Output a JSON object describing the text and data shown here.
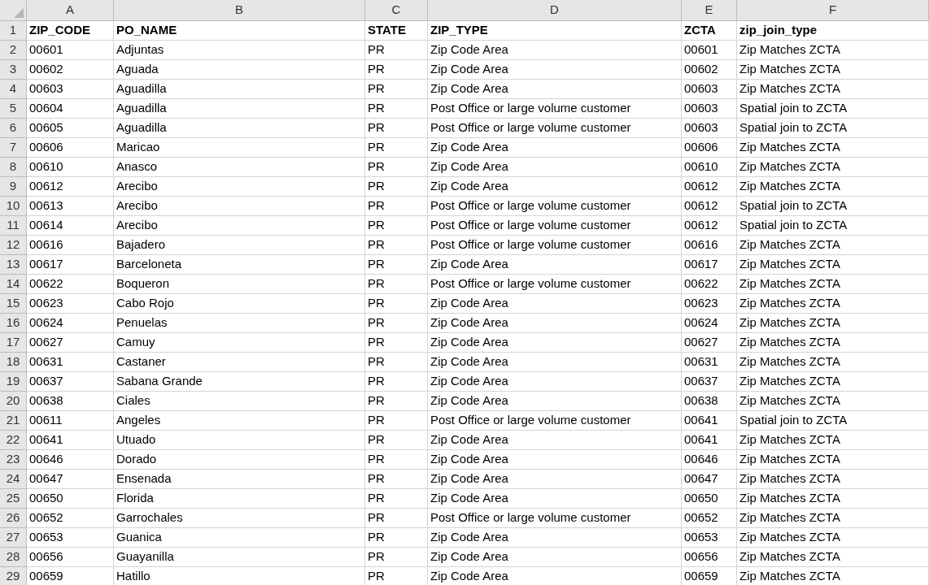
{
  "columns": [
    "A",
    "B",
    "C",
    "D",
    "E",
    "F"
  ],
  "rows": [
    {
      "number": "1",
      "kind": "header",
      "cells": [
        "ZIP_CODE",
        "PO_NAME",
        "STATE",
        "ZIP_TYPE",
        "ZCTA",
        "zip_join_type"
      ]
    },
    {
      "number": "2",
      "kind": "data",
      "cells": [
        "00601",
        "Adjuntas",
        "PR",
        "Zip Code Area",
        "00601",
        "Zip Matches ZCTA"
      ]
    },
    {
      "number": "3",
      "kind": "data",
      "cells": [
        "00602",
        "Aguada",
        "PR",
        "Zip Code Area",
        "00602",
        "Zip Matches ZCTA"
      ]
    },
    {
      "number": "4",
      "kind": "data",
      "cells": [
        "00603",
        "Aguadilla",
        "PR",
        "Zip Code Area",
        "00603",
        "Zip Matches ZCTA"
      ]
    },
    {
      "number": "5",
      "kind": "data",
      "cells": [
        "00604",
        "Aguadilla",
        "PR",
        "Post Office or large volume customer",
        "00603",
        "Spatial join to ZCTA"
      ]
    },
    {
      "number": "6",
      "kind": "data",
      "cells": [
        "00605",
        "Aguadilla",
        "PR",
        "Post Office or large volume customer",
        "00603",
        "Spatial join to ZCTA"
      ]
    },
    {
      "number": "7",
      "kind": "data",
      "cells": [
        "00606",
        "Maricao",
        "PR",
        "Zip Code Area",
        "00606",
        "Zip Matches ZCTA"
      ]
    },
    {
      "number": "8",
      "kind": "data",
      "cells": [
        "00610",
        "Anasco",
        "PR",
        "Zip Code Area",
        "00610",
        "Zip Matches ZCTA"
      ]
    },
    {
      "number": "9",
      "kind": "data",
      "cells": [
        "00612",
        "Arecibo",
        "PR",
        "Zip Code Area",
        "00612",
        "Zip Matches ZCTA"
      ]
    },
    {
      "number": "10",
      "kind": "data",
      "cells": [
        "00613",
        "Arecibo",
        "PR",
        "Post Office or large volume customer",
        "00612",
        "Spatial join to ZCTA"
      ]
    },
    {
      "number": "11",
      "kind": "data",
      "cells": [
        "00614",
        "Arecibo",
        "PR",
        "Post Office or large volume customer",
        "00612",
        "Spatial join to ZCTA"
      ]
    },
    {
      "number": "12",
      "kind": "data",
      "cells": [
        "00616",
        "Bajadero",
        "PR",
        "Post Office or large volume customer",
        "00616",
        "Zip Matches ZCTA"
      ]
    },
    {
      "number": "13",
      "kind": "data",
      "cells": [
        "00617",
        "Barceloneta",
        "PR",
        "Zip Code Area",
        "00617",
        "Zip Matches ZCTA"
      ]
    },
    {
      "number": "14",
      "kind": "data",
      "cells": [
        "00622",
        "Boqueron",
        "PR",
        "Post Office or large volume customer",
        "00622",
        "Zip Matches ZCTA"
      ]
    },
    {
      "number": "15",
      "kind": "data",
      "cells": [
        "00623",
        "Cabo Rojo",
        "PR",
        "Zip Code Area",
        "00623",
        "Zip Matches ZCTA"
      ]
    },
    {
      "number": "16",
      "kind": "data",
      "cells": [
        "00624",
        "Penuelas",
        "PR",
        "Zip Code Area",
        "00624",
        "Zip Matches ZCTA"
      ]
    },
    {
      "number": "17",
      "kind": "data",
      "cells": [
        "00627",
        "Camuy",
        "PR",
        "Zip Code Area",
        "00627",
        "Zip Matches ZCTA"
      ]
    },
    {
      "number": "18",
      "kind": "data",
      "cells": [
        "00631",
        "Castaner",
        "PR",
        "Zip Code Area",
        "00631",
        "Zip Matches ZCTA"
      ]
    },
    {
      "number": "19",
      "kind": "data",
      "cells": [
        "00637",
        "Sabana Grande",
        "PR",
        "Zip Code Area",
        "00637",
        "Zip Matches ZCTA"
      ]
    },
    {
      "number": "20",
      "kind": "data",
      "cells": [
        "00638",
        "Ciales",
        "PR",
        "Zip Code Area",
        "00638",
        "Zip Matches ZCTA"
      ]
    },
    {
      "number": "21",
      "kind": "data",
      "cells": [
        "00611",
        "Angeles",
        "PR",
        "Post Office or large volume customer",
        "00641",
        "Spatial join to ZCTA"
      ]
    },
    {
      "number": "22",
      "kind": "data",
      "cells": [
        "00641",
        "Utuado",
        "PR",
        "Zip Code Area",
        "00641",
        "Zip Matches ZCTA"
      ]
    },
    {
      "number": "23",
      "kind": "data",
      "cells": [
        "00646",
        "Dorado",
        "PR",
        "Zip Code Area",
        "00646",
        "Zip Matches ZCTA"
      ]
    },
    {
      "number": "24",
      "kind": "data",
      "cells": [
        "00647",
        "Ensenada",
        "PR",
        "Zip Code Area",
        "00647",
        "Zip Matches ZCTA"
      ]
    },
    {
      "number": "25",
      "kind": "data",
      "cells": [
        "00650",
        "Florida",
        "PR",
        "Zip Code Area",
        "00650",
        "Zip Matches ZCTA"
      ]
    },
    {
      "number": "26",
      "kind": "data",
      "cells": [
        "00652",
        "Garrochales",
        "PR",
        "Post Office or large volume customer",
        "00652",
        "Zip Matches ZCTA"
      ]
    },
    {
      "number": "27",
      "kind": "data",
      "cells": [
        "00653",
        "Guanica",
        "PR",
        "Zip Code Area",
        "00653",
        "Zip Matches ZCTA"
      ]
    },
    {
      "number": "28",
      "kind": "data",
      "cells": [
        "00656",
        "Guayanilla",
        "PR",
        "Zip Code Area",
        "00656",
        "Zip Matches ZCTA"
      ]
    },
    {
      "number": "29",
      "kind": "data",
      "cells": [
        "00659",
        "Hatillo",
        "PR",
        "Zip Code Area",
        "00659",
        "Zip Matches ZCTA"
      ]
    }
  ]
}
